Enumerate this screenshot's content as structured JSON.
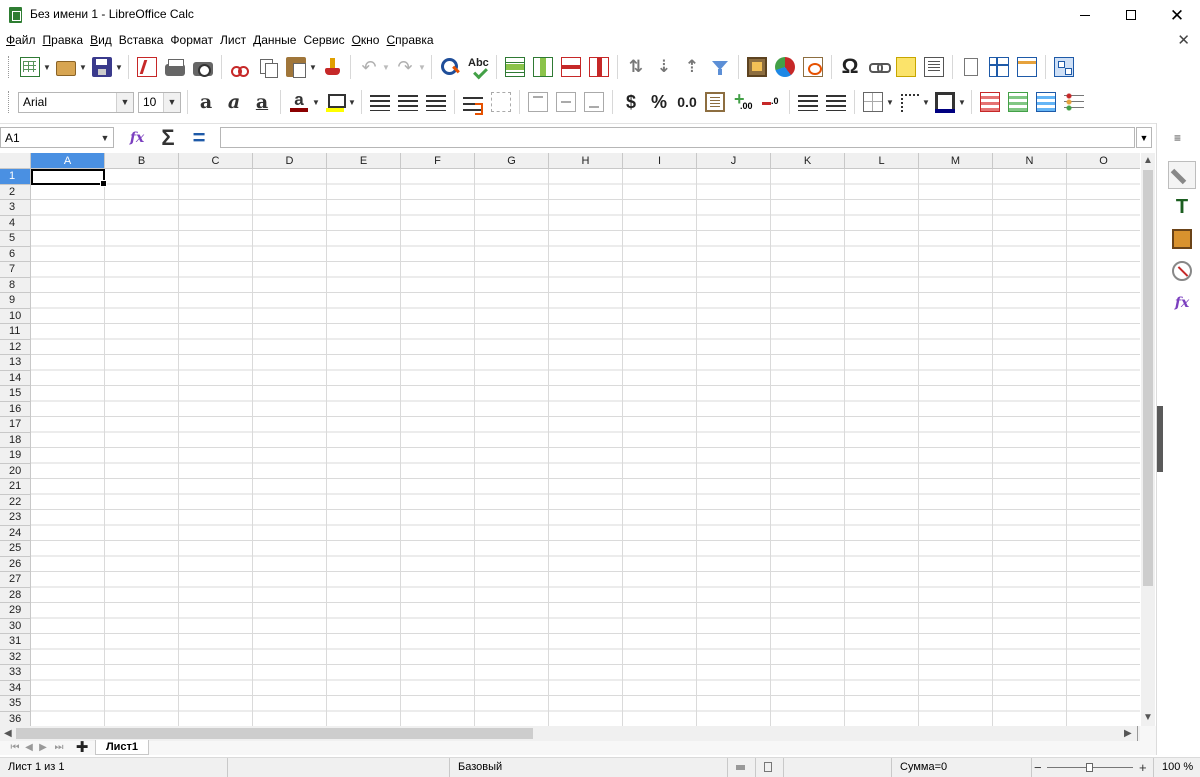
{
  "window": {
    "title": "Без имени 1 - LibreOffice Calc",
    "minimize_glyph": "",
    "close_glyph": "✕"
  },
  "menu": {
    "items": [
      {
        "label": "Файл",
        "underline": "Ф"
      },
      {
        "label": "Правка",
        "underline": "П"
      },
      {
        "label": "Вид",
        "underline": "В"
      },
      {
        "label": "Вставка",
        "underline": ""
      },
      {
        "label": "Формат",
        "underline": ""
      },
      {
        "label": "Лист",
        "underline": ""
      },
      {
        "label": "Данные",
        "underline": ""
      },
      {
        "label": "Сервис",
        "underline": ""
      },
      {
        "label": "Окно",
        "underline": "О"
      },
      {
        "label": "Справка",
        "underline": "С"
      }
    ],
    "close_doc_glyph": "✕"
  },
  "standard_toolbar": {
    "icons": [
      "new-spreadsheet-icon",
      "open-icon",
      "save-icon",
      "export-pdf-icon",
      "print-icon",
      "print-preview-icon",
      "cut-icon",
      "copy-icon",
      "paste-icon",
      "clone-formatting-icon",
      "undo-icon",
      "redo-icon",
      "find-replace-icon",
      "spelling-icon",
      "insert-row-icon",
      "insert-column-icon",
      "delete-row-icon",
      "delete-column-icon",
      "sort-icon",
      "sort-ascending-icon",
      "sort-descending-icon",
      "autofilter-icon",
      "insert-image-icon",
      "insert-chart-icon",
      "pivot-table-icon",
      "special-character-icon",
      "hyperlink-icon",
      "comment-icon",
      "headers-footers-icon",
      "define-print-area-icon",
      "freeze-rows-columns-icon",
      "split-window-icon",
      "show-draw-functions-icon"
    ],
    "spelling_label": "Abc",
    "omega": "Ω",
    "undo_glyph": "↶",
    "redo_glyph": "↷",
    "sort_glyph": "⇅",
    "sort_asc_glyph": "⇣",
    "sort_desc_glyph": "⇡"
  },
  "format_toolbar": {
    "font_name": "Arial",
    "font_size": "10",
    "bold_glyph": "a",
    "italic_glyph": "a",
    "underline_glyph": "a",
    "font_color_glyph": "a",
    "font_color": "#8b0000",
    "highlight_color": "#ffff00",
    "border_color": "#000080",
    "currency_label": "$",
    "percent_label": "%",
    "number_label": "0.0"
  },
  "formula_bar": {
    "name_box": "A1",
    "sum_glyph": "Σ",
    "equals_glyph": "=",
    "fx_glyph": "fx",
    "formula": ""
  },
  "grid": {
    "columns": [
      "A",
      "B",
      "C",
      "D",
      "E",
      "F",
      "G",
      "H",
      "I",
      "J",
      "K",
      "L",
      "M",
      "N",
      "O"
    ],
    "rows": [
      "1",
      "2",
      "3",
      "4",
      "5",
      "6",
      "7",
      "8",
      "9",
      "10",
      "11",
      "12",
      "13",
      "14",
      "15",
      "16",
      "17",
      "18",
      "19",
      "20",
      "21",
      "22",
      "23",
      "24",
      "25",
      "26",
      "27",
      "28",
      "29",
      "30",
      "31",
      "32",
      "33",
      "34",
      "35",
      "36"
    ],
    "selected_column": "A",
    "selected_row": "1",
    "selection_color": "#4a90e2"
  },
  "sidebar": {
    "menu_glyph": "≡",
    "styles_glyph": "T",
    "functions_glyph": "fx",
    "decks": [
      "properties-icon",
      "styles-icon",
      "gallery-icon",
      "navigator-icon",
      "functions-icon"
    ]
  },
  "sheets": {
    "add_glyph": "✚",
    "tabs": [
      "Лист1"
    ]
  },
  "statusbar": {
    "sheet_position": "Лист 1 из 1",
    "page_style": "Базовый",
    "sum": "Сумма=0",
    "zoom_minus": "−",
    "zoom_plus": "+",
    "zoom_level": "100 %"
  }
}
